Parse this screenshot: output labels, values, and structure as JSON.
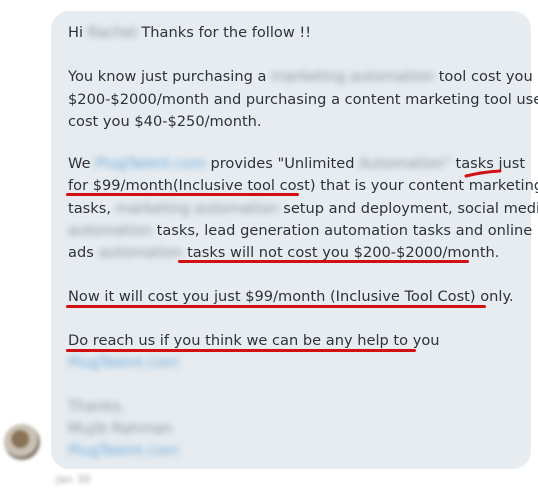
{
  "message": {
    "greeting_prefix": "Hi",
    "name": "Rachel",
    "greeting_suffix": "Thanks for the follow !!",
    "p1": {
      "l1_a": "You know just purchasing a",
      "l1_blur": "marketing automation",
      "l1_b": "tool cost you",
      "l2": "$200-$2000/month and purchasing a content marketing tool use",
      "l3": "cost you $40-$250/month."
    },
    "p2": {
      "l1_a": "We",
      "l1_link": "PlugTalent.com",
      "l1_b": "provides \"Unlimited",
      "l1_blur": "Automation\"",
      "l1_c": "tasks just",
      "l2_a": "for $99/month(Inclusive tool cost)",
      "l2_b": "that is your content marketing",
      "l3_a": "tasks,",
      "l3_blur": "marketing automation",
      "l3_b": "setup and deployment, social media",
      "l4_blur": "automation",
      "l4_b": "tasks, lead generation automation tasks and online",
      "l5_a": "ads",
      "l5_blur": "automation",
      "l5_b": "tasks will not cost you $200-$2000/month."
    },
    "p3": "Now it will cost you just $99/month (Inclusive Tool Cost) only.",
    "p4": "Do reach us if you think we can be any help to you",
    "link": "PlugTalent.com",
    "sig_1": "Thanks,",
    "sig_2": "Mujib Rahman",
    "sig_link": "PlugTalent.com"
  },
  "timestamp": "Jan 30",
  "colors": {
    "bubble": "#e6ecf0",
    "text": "#2e3339",
    "underline": "#d10f14",
    "link": "#6aa6d8"
  }
}
